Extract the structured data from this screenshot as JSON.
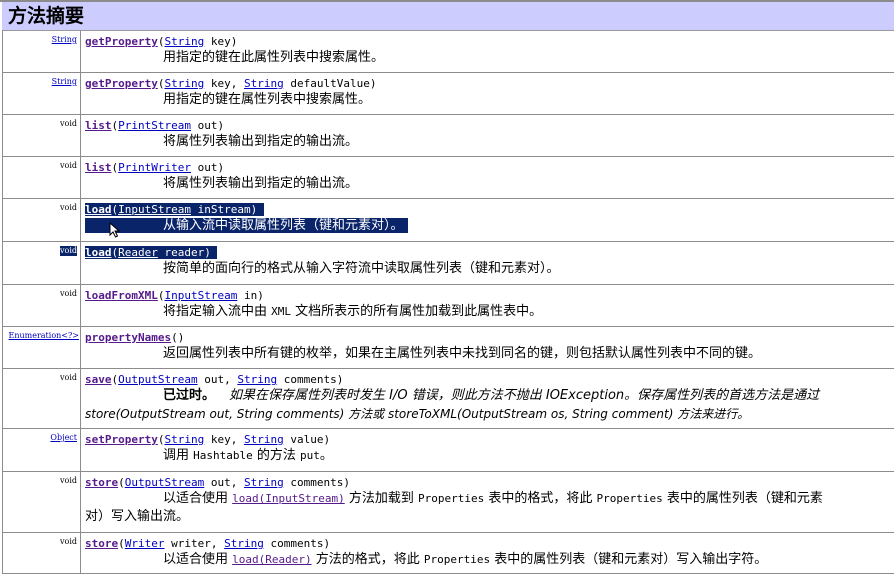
{
  "header": {
    "title": "方法摘要"
  },
  "rows": [
    {
      "type": "String",
      "name": "getProperty",
      "sig_open": "(",
      "p1_type": "String",
      "p1_rest": " key)",
      "desc": "用指定的键在此属性列表中搜索属性。"
    },
    {
      "type": "String",
      "name": "getProperty",
      "sig_open": "(",
      "p1_type": "String",
      "p1_rest": " key, ",
      "p2_type": "String",
      "p2_rest": " defaultValue)",
      "desc": "用指定的键在属性列表中搜索属性。"
    },
    {
      "type": "void",
      "name": "list",
      "sig_open": "(",
      "p1_type": "PrintStream",
      "p1_rest": " out)",
      "desc": "将属性列表输出到指定的输出流。"
    },
    {
      "type": "void",
      "name": "list",
      "sig_open": "(",
      "p1_type": "PrintWriter",
      "p1_rest": " out)",
      "desc": "将属性列表输出到指定的输出流。"
    },
    {
      "type": "void",
      "name": "load",
      "sig_open": "(",
      "p1_type": "InputStream",
      "p1_rest": " inStream)",
      "desc": "从输入流中读取属性列表（键和元素对）。"
    },
    {
      "type": "void",
      "name": "load",
      "sig_open": "(",
      "p1_type": "Reader",
      "p1_rest": " reader)",
      "desc": "按简单的面向行的格式从输入字符流中读取属性列表（键和元素对）。"
    },
    {
      "type": "void",
      "name": "loadFromXML",
      "sig_open": "(",
      "p1_type": "InputStream",
      "p1_rest": " in)",
      "desc_a": "将指定输入流中由 ",
      "desc_code": "XML",
      "desc_b": " 文档所表示的所有属性加载到此属性表中。"
    },
    {
      "type": "Enumeration<?>",
      "name": "propertyNames",
      "sig_open": "()",
      "desc": "返回属性列表中所有键的枚举，如果在主属性列表中未找到同名的键，则包括默认属性列表中不同的键。"
    },
    {
      "type": "void",
      "name": "save",
      "sig_open": "(",
      "p1_type": "OutputStream",
      "p1_rest": " out, ",
      "p2_type": "String",
      "p2_rest": " comments)",
      "deprecated_label": "已过时。",
      "deprecated_text": "如果在保存属性列表时发生 I/O 错误，则此方法不抛出 IOException。保存属性列表的首选方法是通过",
      "deprecated_text2": "store(OutputStream out, String comments) 方法或 storeToXML(OutputStream os, String comment) 方法来进行。"
    },
    {
      "type": "Object",
      "name": "setProperty",
      "sig_open": "(",
      "p1_type": "String",
      "p1_rest": " key, ",
      "p2_type": "String",
      "p2_rest": " value)",
      "desc_a": "调用 ",
      "desc_code": "Hashtable",
      "desc_b": " 的方法 ",
      "desc_code2": "put",
      "desc_c": "。"
    },
    {
      "type": "void",
      "name": "store",
      "sig_open": "(",
      "p1_type": "OutputStream",
      "p1_rest": " out, ",
      "p2_type": "String",
      "p2_rest": " comments)",
      "desc_a": "以适合使用 ",
      "desc_link": "load(InputStream)",
      "desc_b": " 方法加载到 ",
      "desc_code": "Properties",
      "desc_c": " 表中的格式，将此 ",
      "desc_code2": "Properties",
      "desc_d": " 表中的属性列表（键和元素",
      "desc_line2": "对）写入输出流。"
    },
    {
      "type": "void",
      "name": "store",
      "sig_open": "(",
      "p1_type": "Writer",
      "p1_rest": " writer, ",
      "p2_type": "String",
      "p2_rest": " comments)",
      "desc_a": "以适合使用 ",
      "desc_link": "load(Reader)",
      "desc_b": " 方法的格式，将此 ",
      "desc_code": "Properties",
      "desc_c": " 表中的属性列表（键和元素对）写入输出字符。"
    }
  ]
}
